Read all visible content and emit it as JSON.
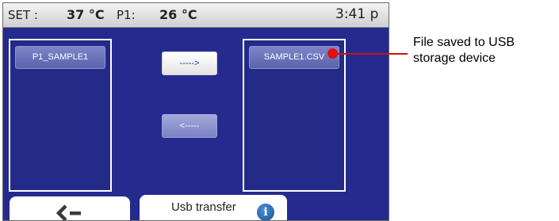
{
  "status_bar": {
    "set_label": "SET :",
    "set_value": "37 °C",
    "probe_label": "P1:",
    "probe_value": "26 °C",
    "time": "3:41 p"
  },
  "left_panel": {
    "items": [
      {
        "label": "P1_SAMPLE1"
      }
    ]
  },
  "right_panel": {
    "items": [
      {
        "label": "SAMPLE1.CSV"
      }
    ]
  },
  "buttons": {
    "copy_to_usb_label": "----->",
    "copy_from_usb_label": "<-----"
  },
  "bottom_bar": {
    "back_icon": "back-arrow-icon",
    "tab_label": "Usb transfer",
    "info_icon": "info-icon",
    "info_glyph": "i"
  },
  "annotation": {
    "text": "File saved to USB storage device",
    "color": "#cc1111"
  },
  "colors": {
    "screen_bg": "#242a8e",
    "file_item": "#6a71b8",
    "status_bar": "#e0e0e0"
  }
}
